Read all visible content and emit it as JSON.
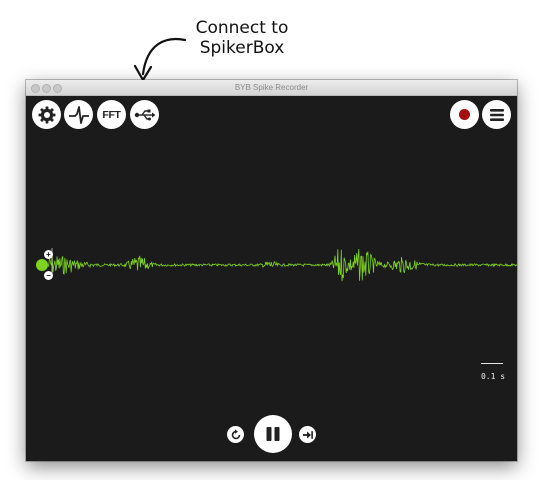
{
  "annotation": {
    "line1": "Connect to",
    "line2": "SpikerBox"
  },
  "window": {
    "title": "BYB Spike Recorder"
  },
  "toolbar": {
    "settings_icon": "gear-icon",
    "threshold_icon": "spike-icon",
    "fft_label": "FFT",
    "usb_icon": "usb-icon",
    "record_icon": "record-icon",
    "menu_icon": "menu-icon"
  },
  "scale": {
    "label": "0.1 s"
  },
  "gain": {
    "plus": "+",
    "minus": "−"
  },
  "playback": {
    "back_icon": "rewind-icon",
    "pause_icon": "pause-icon",
    "forward_icon": "skip-forward-icon"
  },
  "colors": {
    "signal": "#7ed321",
    "background": "#1b1b1b",
    "record": "#a50f0f"
  }
}
